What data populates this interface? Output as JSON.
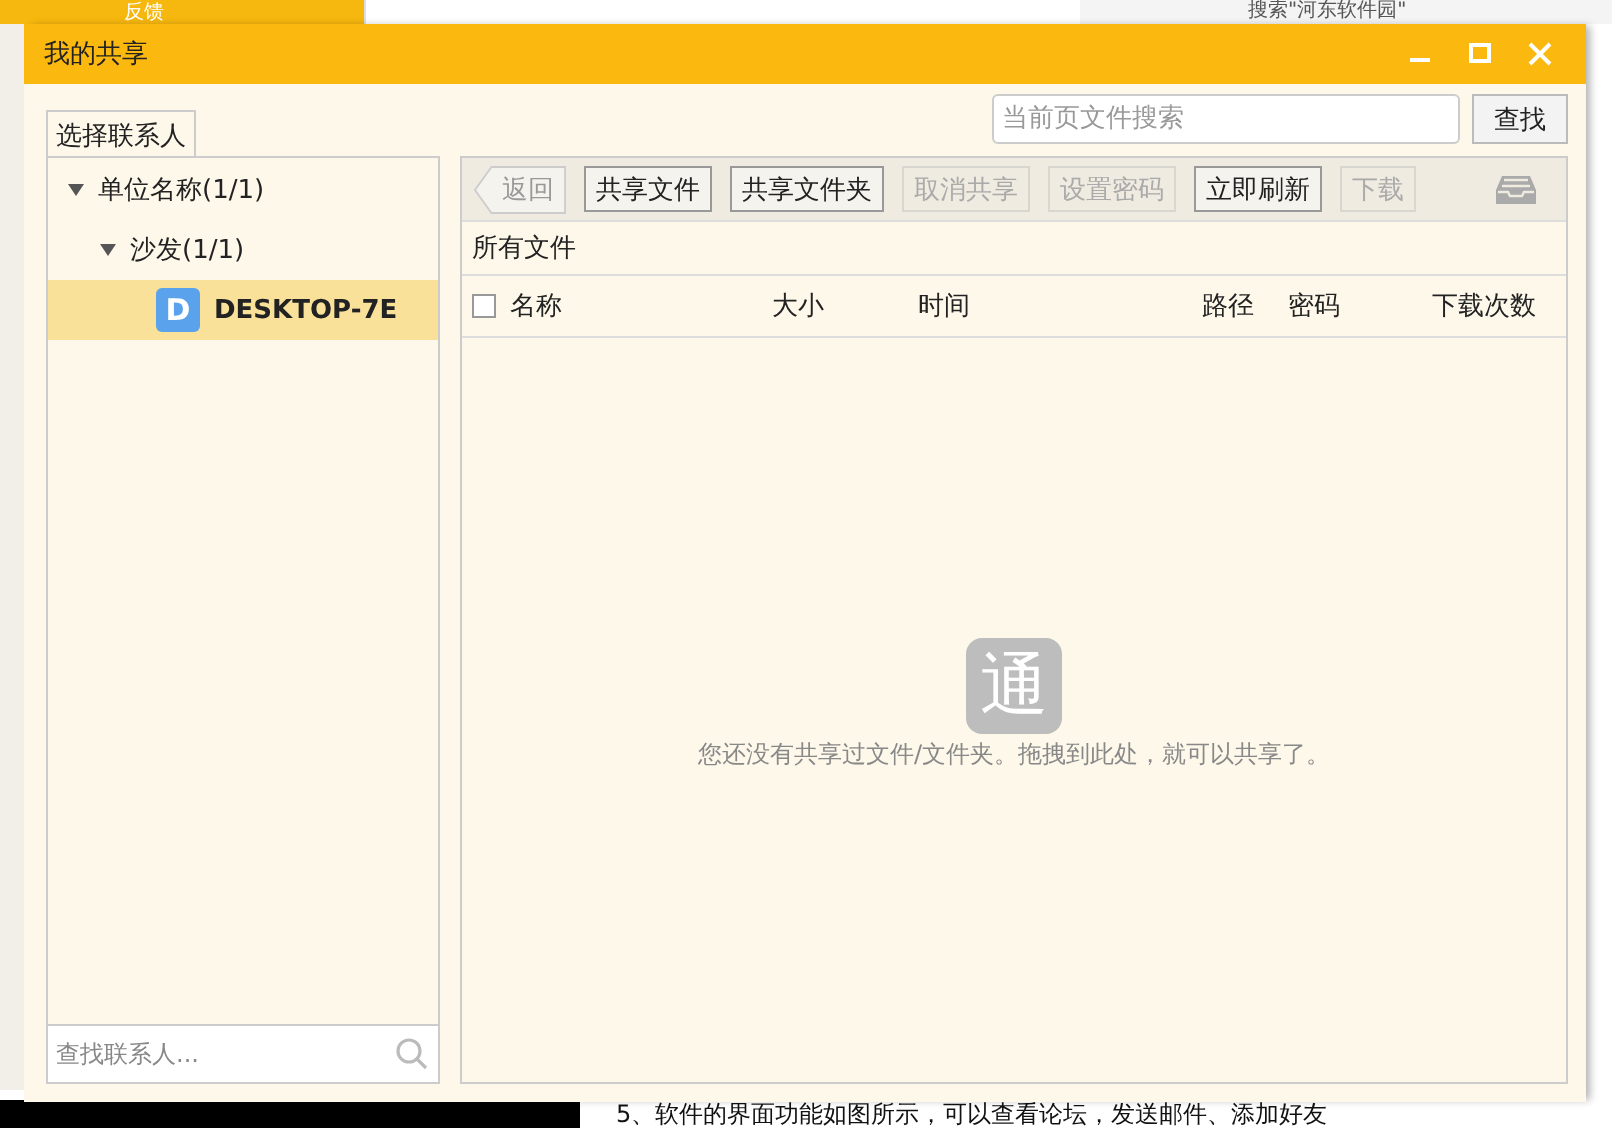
{
  "background": {
    "feedback_window": {
      "title": "反馈"
    },
    "browser": {
      "search_placeholder": "搜索\"河东软件园\""
    },
    "article_text": "5、软件的界面功能如图所示，可以查看论坛，发送邮件、添加好友"
  },
  "window": {
    "title": "我的共享"
  },
  "contacts_tab": {
    "label": "选择联系人",
    "selected": true
  },
  "file_search": {
    "placeholder": "当前页文件搜索",
    "button": "查找"
  },
  "tree": [
    {
      "label": "单位名称(1/1)",
      "expanded": true,
      "children": [
        {
          "label": "沙发(1/1)",
          "expanded": true,
          "children": [
            {
              "label": "DESKTOP-7E",
              "avatar": "D",
              "selected": true
            }
          ]
        }
      ]
    }
  ],
  "contact_search": {
    "placeholder": "查找联系人..."
  },
  "toolbar": {
    "back": {
      "label": "返回",
      "disabled": true
    },
    "buttons": [
      {
        "label": "共享文件",
        "disabled": false
      },
      {
        "label": "共享文件夹",
        "disabled": false
      },
      {
        "label": "取消共享",
        "disabled": true
      },
      {
        "label": "设置密码",
        "disabled": true
      },
      {
        "label": "立即刷新",
        "disabled": false
      },
      {
        "label": "下载",
        "disabled": true
      }
    ]
  },
  "breadcrumb": "所有文件",
  "table": {
    "select_all_checked": false,
    "columns": [
      "名称",
      "大小",
      "时间",
      "路径",
      "密码",
      "下载次数"
    ]
  },
  "empty_state": {
    "logo": "通",
    "message": "您还没有共享过文件/文件夹。拖拽到此处，就可以共享了。"
  }
}
